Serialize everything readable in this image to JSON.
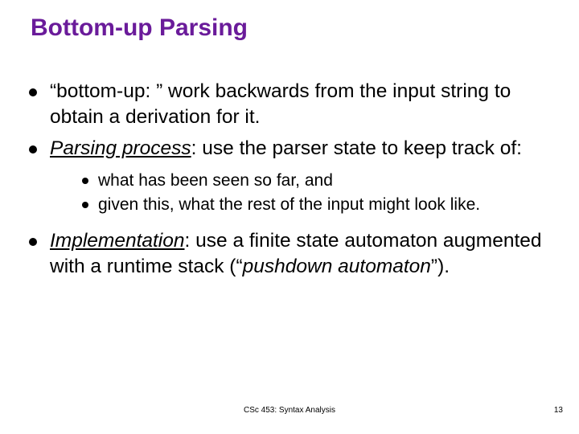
{
  "title": "Bottom-up Parsing",
  "bullets": {
    "b1_a": "“bottom-up: ” work backwards from the input string to obtain a derivation for it.",
    "b2_label": "Parsing process",
    "b2_rest": ": use the parser state to keep track of:",
    "s1": " what has been seen so far, and",
    "s2": "given this, what the rest of the input might look like.",
    "b3_label": "Implementation",
    "b3_mid": ": use a finite state automaton augmented with a runtime stack (“",
    "b3_em": "pushdown automaton",
    "b3_end": "”)."
  },
  "footer": {
    "center": "CSc 453: Syntax Analysis",
    "page": "13"
  }
}
